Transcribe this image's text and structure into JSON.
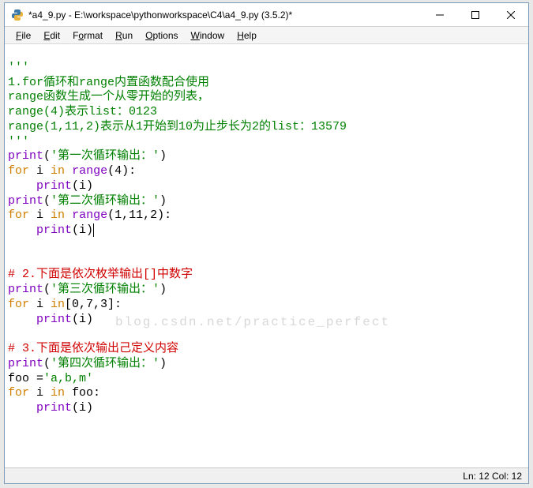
{
  "window": {
    "title": "*a4_9.py - E:\\workspace\\pythonworkspace\\C4\\a4_9.py (3.5.2)*"
  },
  "menu": {
    "file": "File",
    "edit": "Edit",
    "format": "Format",
    "run": "Run",
    "options": "Options",
    "window": "Window",
    "help": "Help"
  },
  "code": {
    "l1": "'''",
    "l2": "1.for循环和range内置函数配合使用",
    "l3": "range函数生成一个从零开始的列表，",
    "l4": "range(4)表示list：0123",
    "l5": "range(1,11,2)表示从1开始到10为止步长为2的list：13579",
    "l6": "'''",
    "l7a": "print",
    "l7b": "(",
    "l7c": "'第一次循环输出：'",
    "l7d": ")",
    "l8a": "for",
    "l8b": " i ",
    "l8c": "in",
    "l8d": " ",
    "l8e": "range",
    "l8f": "(4):",
    "l9a": "    ",
    "l9b": "print",
    "l9c": "(i)",
    "l10a": "print",
    "l10b": "(",
    "l10c": "'第二次循环输出：'",
    "l10d": ")",
    "l11a": "for",
    "l11b": " i ",
    "l11c": "in",
    "l11d": " ",
    "l11e": "range",
    "l11f": "(1,11,2):",
    "l12a": "    ",
    "l12b": "print",
    "l12c": "(i)",
    "l14": "# 2.下面是依次枚举输出[]中数字",
    "l15a": "print",
    "l15b": "(",
    "l15c": "'第三次循环输出：'",
    "l15d": ")",
    "l16a": "for",
    "l16b": " i ",
    "l16c": "in",
    "l16d": "[0,7,3]:",
    "l17a": "    ",
    "l17b": "print",
    "l17c": "(i)",
    "l19": "# 3.下面是依次输出己定义内容",
    "l20a": "print",
    "l20b": "(",
    "l20c": "'第四次循环输出：'",
    "l20d": ")",
    "l21a": "foo =",
    "l21b": "'a,b,m'",
    "l22a": "for",
    "l22b": " i ",
    "l22c": "in",
    "l22d": " foo:",
    "l23a": "    ",
    "l23b": "print",
    "l23c": "(i)"
  },
  "status": {
    "pos": "Ln: 12  Col: 12"
  },
  "watermark": "blog.csdn.net/practice_perfect"
}
